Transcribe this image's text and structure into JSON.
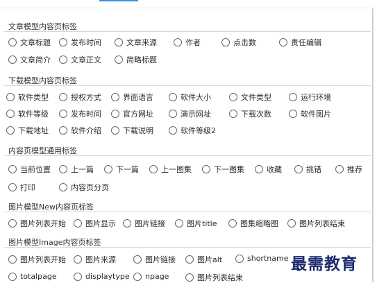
{
  "groups": [
    {
      "title": "文章模型内容页标签",
      "options": [
        "文章标题",
        "发布时间",
        "文章来源",
        "作者",
        "点击数",
        "责任编辑",
        "文章简介",
        "文章正文",
        "简略标题"
      ]
    },
    {
      "title": "下载模型内容页标签",
      "options": [
        "软件类型",
        "授权方式",
        "界面语言",
        "软件大小",
        "文件类型",
        "运行环境",
        "软件等级",
        "发布时间",
        "官方网址",
        "演示网址",
        "下载次数",
        "软件图片",
        "下载地址",
        "软件介绍",
        "下载说明",
        "软件等级2"
      ]
    },
    {
      "title": "内容页模型通用标签",
      "options": [
        "当前位置",
        "上一篇",
        "下一篇",
        "上一图集",
        "下一图集",
        "收藏",
        "挑错",
        "推荐",
        "打印",
        "内容页分页"
      ]
    },
    {
      "title": "图片模型New内容页标签",
      "options": [
        "图片列表开始",
        "图片显示",
        "图片链接",
        "图片title",
        "图集缩略图",
        "图片列表结束"
      ]
    },
    {
      "title": "图片模型Image内容页标签",
      "options": [
        "图片列表开始",
        "图片来源",
        "图片链接",
        "图片alt",
        "shortname",
        "totalpage",
        "displaytype",
        "npage",
        "图片列表结束"
      ]
    }
  ],
  "watermark": "最需教育"
}
